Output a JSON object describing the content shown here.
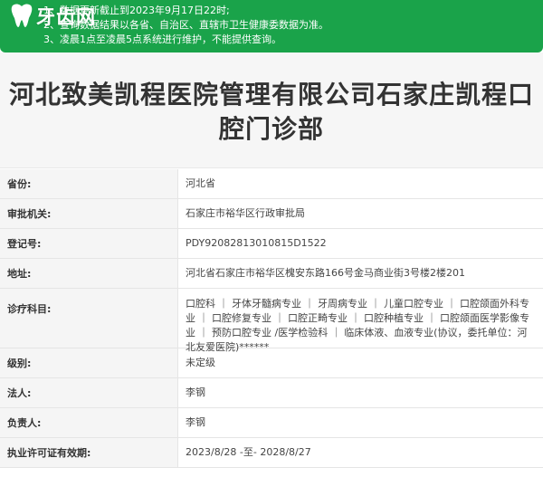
{
  "notice": {
    "line1": "1、数据更新截止到2023年9月17日22时;",
    "line2": "2、查询数据结果以各省、自治区、直辖市卫生健康委数据为准。",
    "line3": "3、凌晨1点至凌晨5点系统进行维护，不能提供查询。"
  },
  "logo": {
    "text": "牙齿网"
  },
  "title": "河北致美凯程医院管理有限公司石家庄凯程口腔门诊部",
  "rows": [
    {
      "label": "省份:",
      "value": "河北省"
    },
    {
      "label": "审批机关:",
      "value": "石家庄市裕华区行政审批局"
    },
    {
      "label": "登记号:",
      "value": "PDY92082813010815D1522"
    },
    {
      "label": "地址:",
      "value": "河北省石家庄市裕华区槐安东路166号金马商业街3号楼2楼201"
    },
    {
      "label": "诊疗科目:",
      "value": "口腔科 ｜ 牙体牙髓病专业 ｜ 牙周病专业 ｜ 儿童口腔专业 ｜ 口腔颌面外科专业 ｜ 口腔修复专业 ｜ 口腔正畸专业 ｜ 口腔种植专业 ｜ 口腔颌面医学影像专业 ｜ 预防口腔专业 /医学检验科 ｜ 临床体液、血液专业(协议，委托单位：河北友爱医院)******"
    },
    {
      "label": "级别:",
      "value": "未定级"
    },
    {
      "label": "法人:",
      "value": "李钢"
    },
    {
      "label": "负责人:",
      "value": "李钢"
    },
    {
      "label": "执业许可证有效期:",
      "value": "2023/8/28 -至- 2028/8/27"
    }
  ],
  "colors": {
    "notice_bg": "#1aa34a",
    "label_bg": "#f5f5f5"
  }
}
